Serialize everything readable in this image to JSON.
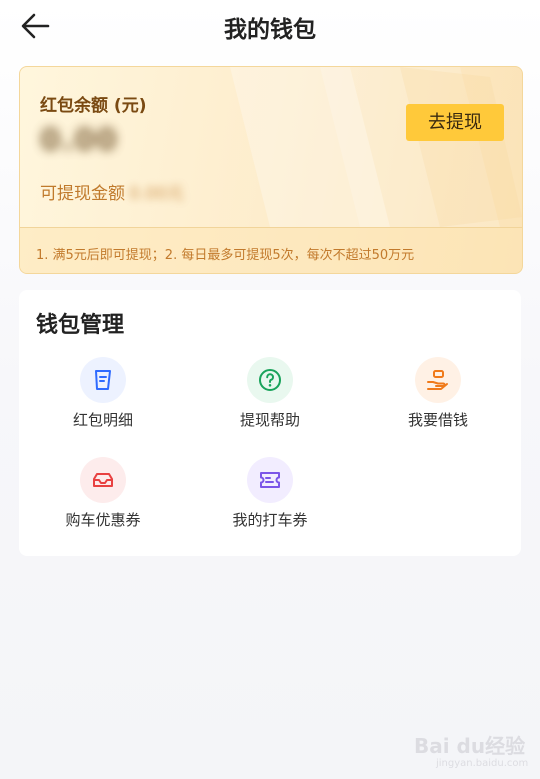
{
  "header": {
    "title": "我的钱包"
  },
  "balance": {
    "label": "红包余额 (元)",
    "amount": "0.00",
    "withdrawable_label": "可提现金额",
    "withdrawable_value": "0.00元",
    "withdraw_button": "去提现",
    "rules": "1. 满5元后即可提现；2. 每日最多可提现5次，每次不超过50万元"
  },
  "wallet_manage": {
    "title": "钱包管理",
    "items": [
      {
        "label": "红包明细",
        "icon": "document-icon",
        "color": "#2f6bff",
        "bg": "#edf2ff"
      },
      {
        "label": "提现帮助",
        "icon": "question-circle-icon",
        "color": "#1aa35b",
        "bg": "#e9f8ef"
      },
      {
        "label": "我要借钱",
        "icon": "hand-coin-icon",
        "color": "#f07a1a",
        "bg": "#fff1e5"
      },
      {
        "label": "购车优惠券",
        "icon": "car-icon",
        "color": "#e84141",
        "bg": "#fdecec"
      },
      {
        "label": "我的打车券",
        "icon": "ticket-icon",
        "color": "#7b55e8",
        "bg": "#f2edff"
      }
    ]
  },
  "watermark": {
    "brand": "Bai du经验",
    "url": "jingyan.baidu.com"
  }
}
